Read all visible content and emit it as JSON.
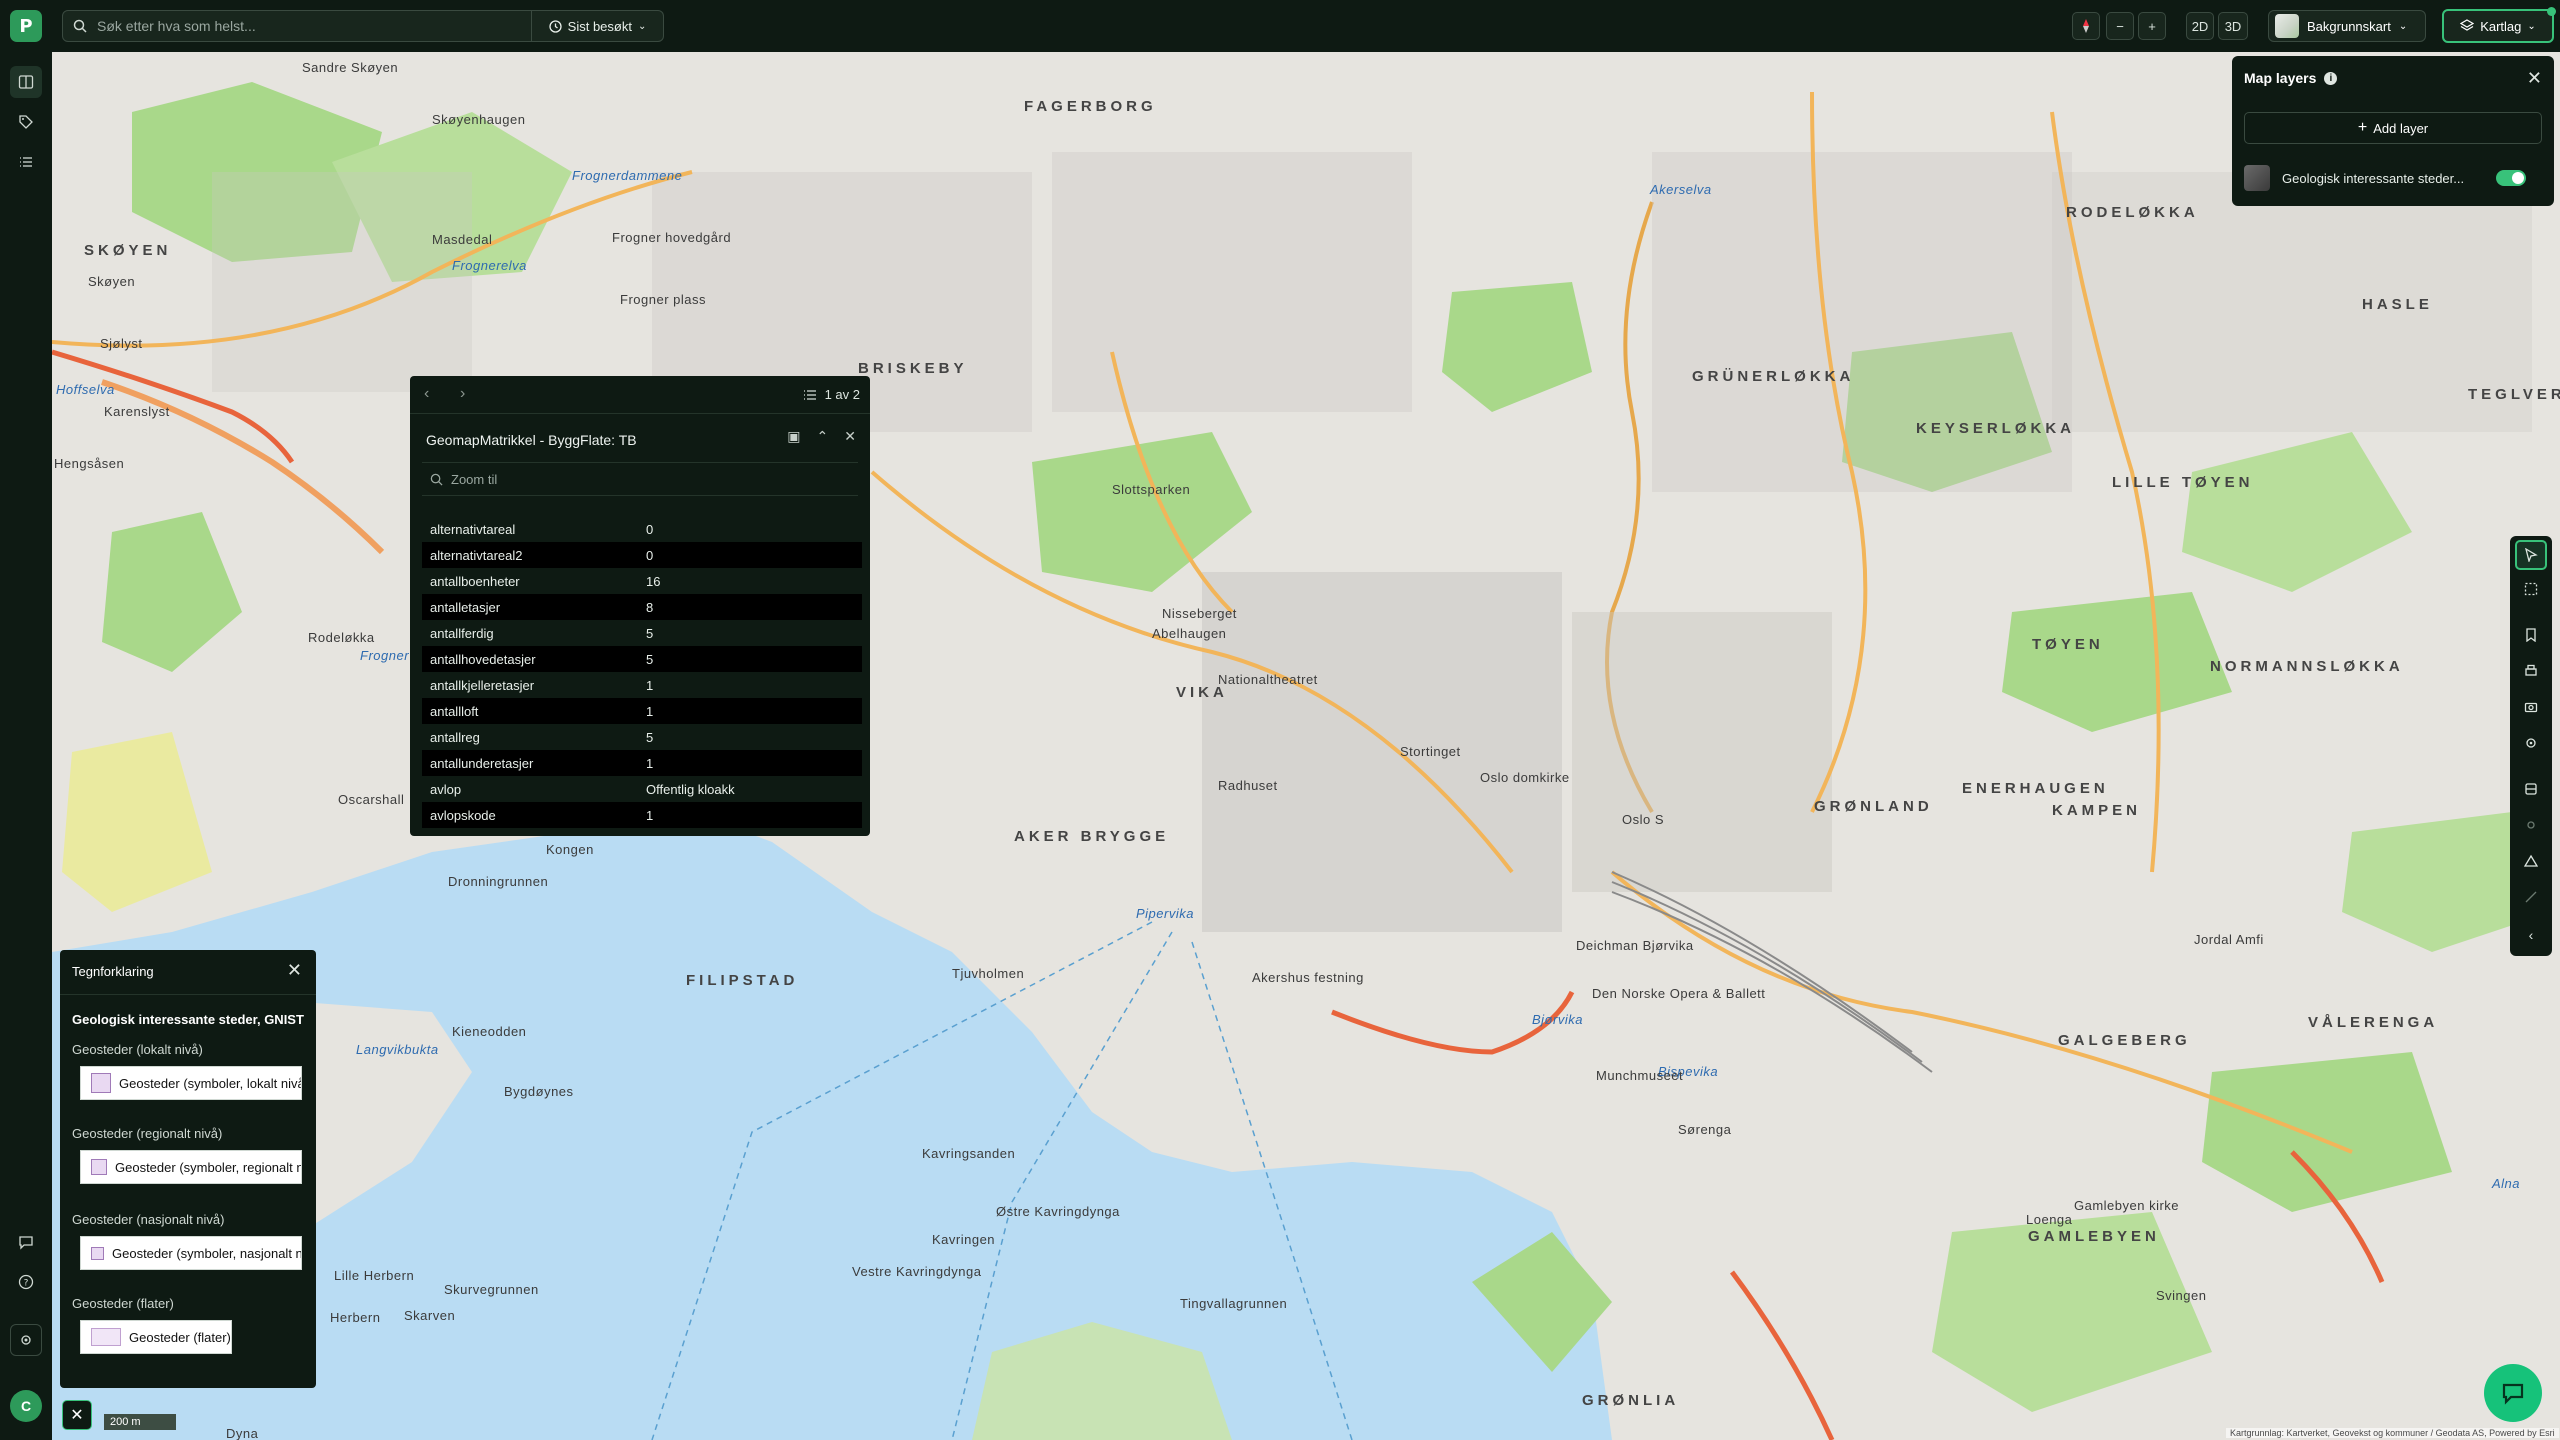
{
  "topbar": {
    "logo": "P",
    "search_placeholder": "Søk etter hva som helst...",
    "recent_label": "Sist besøkt",
    "view_2d": "2D",
    "view_3d": "3D",
    "zoom_out": "−",
    "zoom_in": "+",
    "background_label": "Bakgrunnskart",
    "layers_button": "Kartlag"
  },
  "map_layers": {
    "title": "Map layers",
    "add_layer": "Add layer",
    "layer_name": "Geologisk interessante steder...",
    "layer_enabled": true
  },
  "popup": {
    "count": "1 av 2",
    "title": "GeomapMatrikkel - ByggFlate: TB",
    "zoom_to": "Zoom til",
    "attributes": [
      {
        "key": "alternativtareal",
        "value": "0"
      },
      {
        "key": "alternativtareal2",
        "value": "0"
      },
      {
        "key": "antallboenheter",
        "value": "16"
      },
      {
        "key": "antalletasjer",
        "value": "8"
      },
      {
        "key": "antallferdig",
        "value": "5"
      },
      {
        "key": "antallhovedetasjer",
        "value": "5"
      },
      {
        "key": "antallkjelleretasjer",
        "value": "1"
      },
      {
        "key": "antallloft",
        "value": "1"
      },
      {
        "key": "antallreg",
        "value": "5"
      },
      {
        "key": "antallunderetasjer",
        "value": "1"
      },
      {
        "key": "avlop",
        "value": "Offentlig kloakk"
      },
      {
        "key": "avlopskode",
        "value": "1"
      }
    ]
  },
  "legend": {
    "header": "Tegnforklaring",
    "layer_title": "Geologisk interessante steder, GNIST",
    "groups": [
      {
        "title": "Geosteder (lokalt nivå)",
        "item": "Geosteder (symboler, lokalt nivå)"
      },
      {
        "title": "Geosteder (regionalt nivå)",
        "item": "Geosteder (symboler, regionalt nivå)"
      },
      {
        "title": "Geosteder (nasjonalt nivå)",
        "item": "Geosteder (symboler, nasjonalt nivå)"
      },
      {
        "title": "Geosteder (flater)",
        "item": "Geosteder (flater)"
      }
    ]
  },
  "map": {
    "scale_label": "200 m",
    "attribution": "Kartgrunnlag: Kartverket, Geovekst og kommuner / Geodata AS, Powered by Esri",
    "user_initial": "C",
    "places": [
      {
        "name": "FAGERBORG",
        "kind": "big"
      },
      {
        "name": "RODELØKKA",
        "kind": "big"
      },
      {
        "name": "SKØYEN",
        "kind": "big"
      },
      {
        "name": "BRISKEBY",
        "kind": "big"
      },
      {
        "name": "GRÜNERLØKKA",
        "kind": "big"
      },
      {
        "name": "HASLE",
        "kind": "big"
      },
      {
        "name": "KEYSERLØKKA",
        "kind": "big"
      },
      {
        "name": "TEGLVERKSDAMMEN",
        "kind": "big"
      },
      {
        "name": "LILLE TØYEN",
        "kind": "big"
      },
      {
        "name": "TØYEN",
        "kind": "big"
      },
      {
        "name": "NORMANNSLØKKA",
        "kind": "big"
      },
      {
        "name": "ENERHAUGEN",
        "kind": "big"
      },
      {
        "name": "GRØNLAND",
        "kind": "big"
      },
      {
        "name": "KAMPEN",
        "kind": "big"
      },
      {
        "name": "AKER BRYGGE",
        "kind": "big"
      },
      {
        "name": "VIKA",
        "kind": "big"
      },
      {
        "name": "FILIPSTAD",
        "kind": "big"
      },
      {
        "name": "GALGEBERG",
        "kind": "big"
      },
      {
        "name": "VÅLERENGA",
        "kind": "big"
      },
      {
        "name": "GAMLEBYEN",
        "kind": "big"
      },
      {
        "name": "GRØNLIA",
        "kind": "big"
      },
      {
        "name": "Frognerelva",
        "kind": "water"
      },
      {
        "name": "Akerselva",
        "kind": "water"
      },
      {
        "name": "Pipervika",
        "kind": "water"
      },
      {
        "name": "Bjørvika",
        "kind": "water"
      },
      {
        "name": "Bispevika",
        "kind": "water"
      },
      {
        "name": "Langvikbukta",
        "kind": "water"
      },
      {
        "name": "Hoffselva",
        "kind": "water"
      },
      {
        "name": "Alna",
        "kind": "water"
      },
      {
        "name": "Frognerdammene",
        "kind": "water"
      },
      {
        "name": "Frogner",
        "kind": "water"
      },
      {
        "name": "Nisseberget",
        "kind": "normal"
      },
      {
        "name": "Abelhaugen",
        "kind": "normal"
      },
      {
        "name": "Hengsåsen",
        "kind": "normal"
      },
      {
        "name": "Kavringsanden",
        "kind": "normal"
      },
      {
        "name": "Østre Kavringdynga",
        "kind": "normal"
      },
      {
        "name": "Vestre Kavringdynga",
        "kind": "normal"
      },
      {
        "name": "Kavringen",
        "kind": "normal"
      },
      {
        "name": "Tingvallagrunnen",
        "kind": "normal"
      },
      {
        "name": "Lille Herbern",
        "kind": "normal"
      },
      {
        "name": "Herbern",
        "kind": "normal"
      },
      {
        "name": "Skarven",
        "kind": "normal"
      },
      {
        "name": "Skurvegrunnen",
        "kind": "normal"
      },
      {
        "name": "Bygdøynes",
        "kind": "normal"
      },
      {
        "name": "Kieneodden",
        "kind": "normal"
      },
      {
        "name": "Dronningrunnen",
        "kind": "normal"
      },
      {
        "name": "Tjuvholmen",
        "kind": "normal"
      },
      {
        "name": "Akershus festning",
        "kind": "normal"
      },
      {
        "name": "Munchmuseet",
        "kind": "normal"
      },
      {
        "name": "Sørenga",
        "kind": "normal"
      },
      {
        "name": "Oslo S",
        "kind": "normal"
      },
      {
        "name": "Kongen",
        "kind": "normal"
      },
      {
        "name": "Rodeløkka",
        "kind": "normal"
      },
      {
        "name": "Oscarshall",
        "kind": "normal"
      },
      {
        "name": "Karenslyst",
        "kind": "normal"
      },
      {
        "name": "Sjølyst",
        "kind": "normal"
      },
      {
        "name": "Skøyen",
        "kind": "normal"
      },
      {
        "name": "Masdedal",
        "kind": "normal"
      },
      {
        "name": "Skøyenhaugen",
        "kind": "normal"
      },
      {
        "name": "Sandre Skøyen",
        "kind": "normal"
      },
      {
        "name": "Frogner hovedgård",
        "kind": "normal"
      },
      {
        "name": "Frogner plass",
        "kind": "normal"
      },
      {
        "name": "Slottsparken",
        "kind": "normal"
      },
      {
        "name": "Radhuset",
        "kind": "normal"
      },
      {
        "name": "Stortinget",
        "kind": "normal"
      },
      {
        "name": "Nationaltheatret",
        "kind": "normal"
      },
      {
        "name": "Oslo domkirke",
        "kind": "normal"
      },
      {
        "name": "Deichman Bjørvika",
        "kind": "normal"
      },
      {
        "name": "Den Norske Opera & Ballett",
        "kind": "normal"
      },
      {
        "name": "Jordal Amfi",
        "kind": "normal"
      },
      {
        "name": "Gamlebyen kirke",
        "kind": "normal"
      },
      {
        "name": "Svingen",
        "kind": "normal"
      },
      {
        "name": "Loenga",
        "kind": "normal"
      },
      {
        "name": "Dyna",
        "kind": "normal"
      }
    ]
  }
}
